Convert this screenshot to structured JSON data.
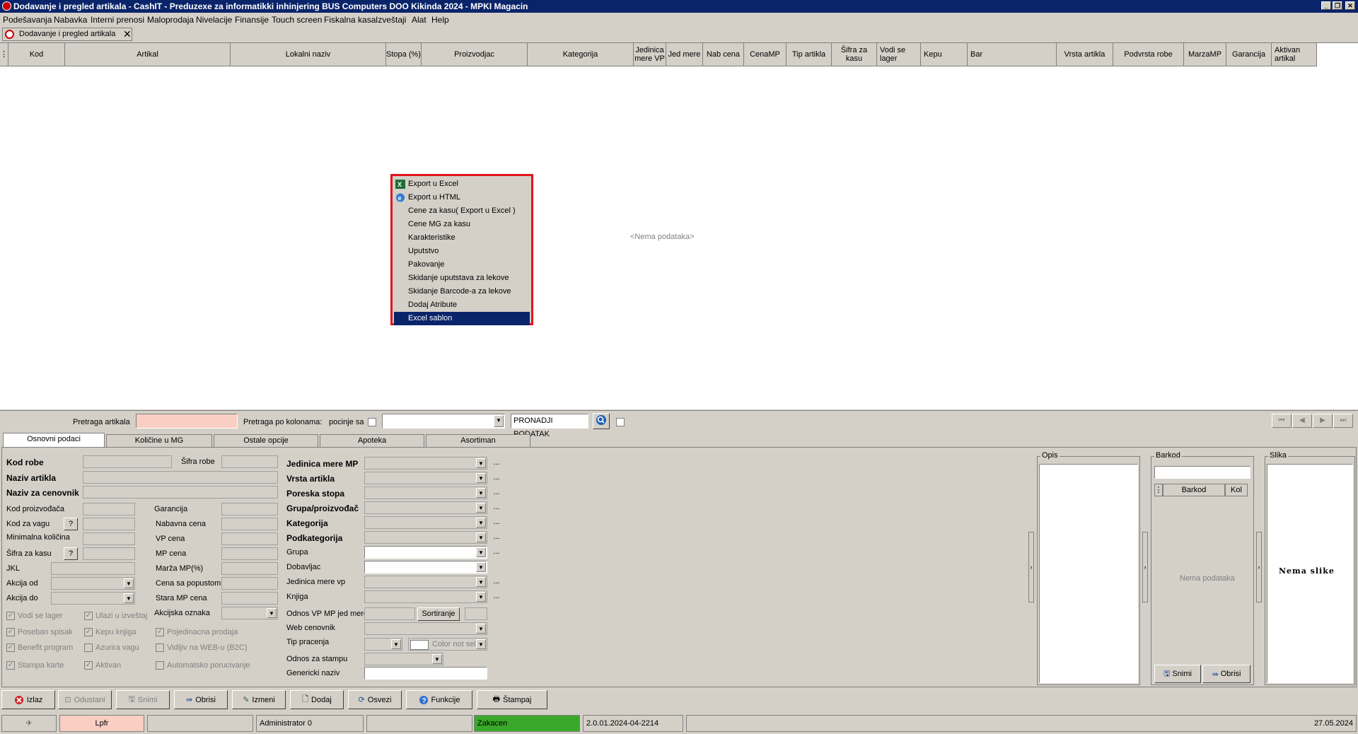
{
  "window": {
    "title": "Dodavanje i pregled artikala - CashIT - Preduzexe za informatikki inhinjering BUS Computers DOO Kikinda 2024 - MPKI Magacin"
  },
  "menu": [
    "Podešavanja",
    "Nabavka",
    "Interni prenosi",
    "Maloprodaja",
    "Nivelacije",
    "Finansije",
    "Touch screen",
    "Fiskalna kasa",
    "Izveštaji",
    "Alat",
    "Help"
  ],
  "doc_tab": {
    "label": "Dodavanje i pregled artikala",
    "close": "✕"
  },
  "grid": {
    "columns": [
      "Kod",
      "Artikal",
      "Lokalni naziv",
      "Stopa (%)",
      "Proizvodjac",
      "Kategorija",
      "Jedinica mere VP",
      "Jed mere",
      "Nab cena",
      "CenaMP",
      "Tip artikla",
      "Šifra za kasu",
      "Vodi se lager",
      "Kepu",
      "Bar",
      "Vrsta artikla",
      "Podvrsta robe",
      "MarzaMP",
      "Garancija",
      "Aktivan artikal"
    ],
    "empty_text": "<Nema podataka>"
  },
  "context_menu": {
    "items": [
      "Export u Excel",
      "Export u HTML",
      "Cene za kasu( Export u Excel )",
      "Cene MG za kasu",
      "Karakteristike",
      "Uputstvo",
      "Pakovanje",
      "Skidanje uputstava za lekove",
      "Skidanje Barcode-a za lekove",
      "Dodaj Atribute",
      "Excel sablon"
    ],
    "selected": "Excel sablon",
    "highlight_color": "#e1141e"
  },
  "search": {
    "label": "Pretraga artikala",
    "by_columns_label": "Pretraga po kolonama:",
    "starts_with_label": "pocinje sa",
    "find_button": "PRONADJI PODATAK"
  },
  "tabs": [
    "Osnovni podaci",
    "Količine u MG",
    "Ostale opcije",
    "Apoteka",
    "Asortiman"
  ],
  "form": {
    "kod_robe": "Kod robe",
    "sifra_robe": "Šifra robe",
    "naziv_artikla": "Naziv artikla",
    "naziv_za_cenovnik": "Naziv za cenovnik",
    "kod_proizvodjaca": "Kod proizvođača",
    "kod_za_vagu": "Kod za vagu",
    "minimalna_kolicina": "Minimalna količina",
    "sifra_za_kasu": "Šifra za kasu",
    "jkl": "JKL",
    "akcija_od": "Akcija od",
    "akcija_do": "Akcija do",
    "garancija": "Garancija",
    "nabavna_cena": "Nabavna cena",
    "vp_cena": "VP cena",
    "mp_cena": "MP cena",
    "marza_mp": "Marža MP(%)",
    "cena_sa_popustom": "Cena sa popustom",
    "stara_mp_cena": "Stara MP cena",
    "akcijska_oznaka": "Akcijska oznaka",
    "question": "?",
    "jedinica_mere_mp": "Jedinica mere MP",
    "vrsta_artikla": "Vrsta artikla",
    "poreska_stopa": "Poreska stopa",
    "grupa_proizvodjac": "Grupa/proizvođač",
    "kategorija": "Kategorija",
    "podkategorija": "Podkategorija",
    "grupa": "Grupa",
    "dobavljac": "Dobavljac",
    "jedinica_mere_vp": "Jedinica mere vp",
    "knjiga": "Knjiga",
    "odnos_vp_mp": "Odnos VP MP jed mere",
    "sortiranje": "Sortiranje",
    "web_cenovnik": "Web cenovnik",
    "tip_pracenja": "Tip pracenja",
    "color_not_sel": "Color not sel",
    "odnos_za_stampu": "Odnos za stampu",
    "genericki_naziv": "Genericki naziv",
    "dots": "..."
  },
  "checkboxes": [
    {
      "label": "Vodi se lager",
      "checked": true
    },
    {
      "label": "Ulazi u izveštaj",
      "checked": true
    },
    {
      "label": "Poseban spisak",
      "checked": true
    },
    {
      "label": "Kepu knjiga",
      "checked": true
    },
    {
      "label": "Pojedinacna prodaja",
      "checked": true
    },
    {
      "label": "Benefit program",
      "checked": true
    },
    {
      "label": "Azurira vagu",
      "checked": false
    },
    {
      "label": "Vidljiv na WEB-u (B2C)",
      "checked": false
    },
    {
      "label": "Stampa karte",
      "checked": true
    },
    {
      "label": "Aktivan",
      "checked": true
    },
    {
      "label": "Automatsko porucivanje",
      "checked": false
    }
  ],
  "panels": {
    "opis": "Opis",
    "barkod": "Barkod",
    "barkod_col1": "Barkod",
    "barkod_col2": "Kol",
    "barkod_empty": "Nema podataka",
    "barkod_save": "Snimi",
    "barkod_delete": "Obrisi",
    "slika": "Slika",
    "slika_empty": "Nema slike"
  },
  "buttons": [
    "Izlaz",
    "Odustani",
    "Snimi",
    "Obrisi",
    "Izmeni",
    "Dodaj",
    "Osvezi",
    "Funkcije",
    "Štampaj"
  ],
  "statusbar": {
    "lpfr": "Lpfr",
    "user": "Administrator 0",
    "zakacen": "Zakacen",
    "version": "2.0.01.2024-04-2214",
    "date": "27.05.2024"
  },
  "nav_icons": [
    "first-icon",
    "prev-icon",
    "next-icon",
    "last-icon"
  ],
  "colors": {
    "title_bg": "#0a246a",
    "search_input_bg": "#f9cfc3",
    "lpfr_bg": "#f9cfc3",
    "zakacen_bg": "#3aa82a"
  }
}
